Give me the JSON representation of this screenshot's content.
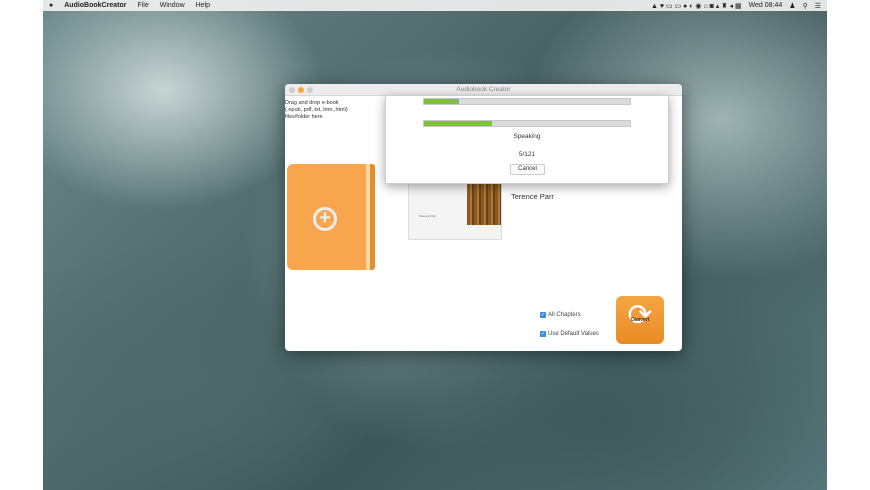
{
  "menubar": {
    "app": "AudioBookCreator",
    "items": [
      "File",
      "Window",
      "Help"
    ],
    "clock": "Wed 08:44"
  },
  "window": {
    "title": "Audiobook Creator",
    "drop_hint": "Drag and drop e-book (.epub,.pdf,.txt,.htm,.html) files/folder here",
    "author": "Terence Parr",
    "cover_text": "Terence Parr",
    "options": [
      {
        "label": "All Chapters",
        "checked": true
      },
      {
        "label": "Use Default Values",
        "checked": true
      }
    ],
    "convert_label": "Convert"
  },
  "progress": {
    "bar1_percent": 17,
    "bar2_percent": 33,
    "status": "Speaking",
    "count": "5/121",
    "cancel_label": "Cancel"
  },
  "colors": {
    "accent": "#f7a64d",
    "progress": "#7ec13a"
  }
}
